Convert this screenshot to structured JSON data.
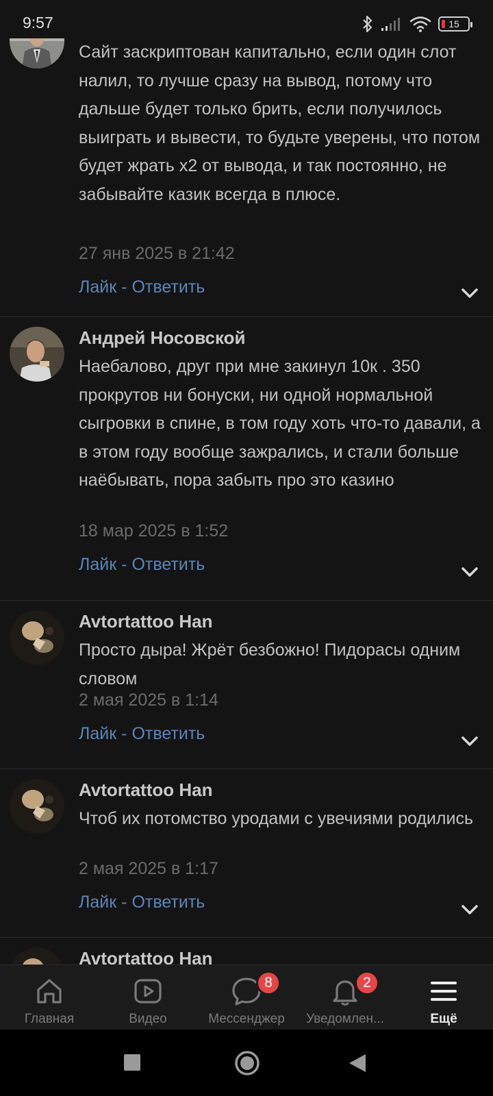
{
  "status_bar": {
    "time": "9:57",
    "battery": "15"
  },
  "comments": [
    {
      "author": "",
      "text": "Сайт заскриптован капитально, если один слот налил, то лучше сразу на вывод, потому что дальше будет только брить, если получилось выиграть и вывести, то будьте уверены, что потом будет жрать х2 от вывода, и так постоянно, не забывайте казик всегда в плюсе.",
      "date": "27 янв 2025 в 21:42",
      "like": "Лайк",
      "separator": " - ",
      "reply": "Ответить"
    },
    {
      "author": "Андрей Носовской",
      "text": "Наебалово, друг при мне закинул 10к . 350 прокрутов ни бонуски, ни одной нормальной сыгровки в спине, в том году хоть что-то давали, а в этом году вообще зажрались, и стали больше наёбывать, пора забыть про это казино",
      "date": "18 мар 2025 в 1:52",
      "like": "Лайк",
      "separator": " - ",
      "reply": "Ответить"
    },
    {
      "author": "Avtortattoo Han",
      "text": "Просто дыра! Жрёт безбожно! Пидорасы одним словом",
      "date": "2 мая 2025 в 1:14",
      "like": "Лайк",
      "separator": " - ",
      "reply": "Ответить"
    },
    {
      "author": "Avtortattoo Han",
      "text": "Чтоб их потомство уродами с увечиями родились",
      "date": "2 мая 2025 в 1:17",
      "like": "Лайк",
      "separator": " - ",
      "reply": "Ответить"
    },
    {
      "author": "Avtortattoo Han"
    }
  ],
  "bottom_nav": {
    "items": [
      {
        "label": "Главная",
        "icon": "home-icon"
      },
      {
        "label": "Видео",
        "icon": "video-icon"
      },
      {
        "label": "Мессенджер",
        "icon": "messenger-icon",
        "badge": "8"
      },
      {
        "label": "Уведомлен...",
        "icon": "bell-icon",
        "badge": "2"
      },
      {
        "label": "Ещё",
        "icon": "menu-icon",
        "active": true
      }
    ]
  },
  "colors": {
    "background": "#141414",
    "link": "#5a86b8",
    "badge": "#e64646"
  }
}
